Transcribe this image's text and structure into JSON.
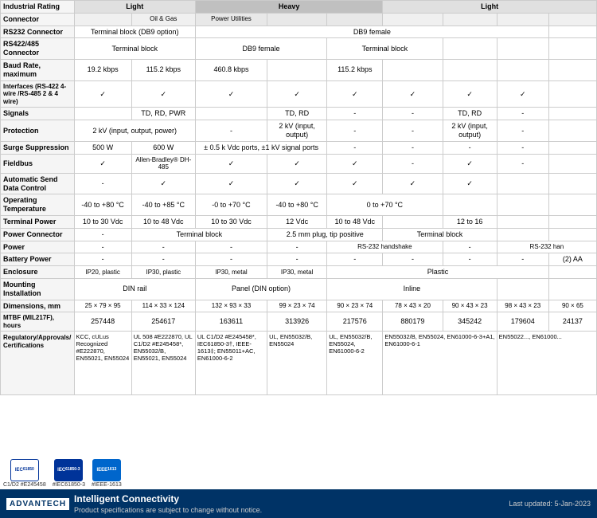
{
  "header": {
    "industrial_rating_label": "Industrial Rating",
    "cols": [
      "Light",
      "Heavy",
      "Light"
    ],
    "col_detail": [
      "Oil & Gas",
      "Power Utilities",
      ""
    ]
  },
  "rows": [
    {
      "label": "RS232 Connector",
      "values": [
        "Terminal block (DB9 option)",
        "DB9 female",
        "",
        "",
        "",
        "",
        "",
        ""
      ]
    },
    {
      "label": "RS422/485 Connector",
      "values": [
        "Terminal block",
        "",
        "DB9 female",
        "Terminal block",
        "",
        "",
        "",
        ""
      ]
    },
    {
      "label": "Baud Rate, maximum",
      "values": [
        "19.2 kbps",
        "115.2 kbps",
        "460.8 kbps",
        "",
        "115.2 kbps",
        "",
        "",
        ""
      ]
    },
    {
      "label": "Interfaces (RS-422 4-wire /RS-485 2 & 4 wire)",
      "values": [
        "✓",
        "✓",
        "✓",
        "✓",
        "✓",
        "✓",
        "✓",
        "✓"
      ]
    },
    {
      "label": "Signals",
      "values": [
        "",
        "TD, RD, PWR",
        "",
        "TD, RD",
        "-",
        "-",
        "TD, RD",
        "-"
      ]
    },
    {
      "label": "Protection",
      "values": [
        "2 kV (input, output, power)",
        "",
        "2 kV (input, output)",
        "-",
        "-",
        "2 kV (input, output)",
        "-"
      ]
    },
    {
      "label": "Surge Suppression",
      "values": [
        "500 W",
        "600 W",
        "± 0.5 k Vdc ports, ±1 kV signal ports",
        "-",
        "-",
        "-",
        "-"
      ]
    },
    {
      "label": "Fieldbus",
      "values": [
        "✓",
        "Allen-Bradley® DH-485",
        "✓",
        "✓",
        "✓",
        "-",
        "✓",
        "-"
      ]
    },
    {
      "label": "Automatic Send Data Control",
      "values": [
        "-",
        "✓",
        "✓",
        "✓",
        "✓",
        "✓",
        "",
        ""
      ]
    },
    {
      "label": "Operating Temperature",
      "values": [
        "-40 to +80 °C",
        "-40 to +85 °C",
        "-0 to +70 °C",
        "-40 to +80 °C",
        "0 to +70 °C",
        "",
        ""
      ]
    },
    {
      "label": "Terminal Power",
      "values": [
        "10 to 30 Vdc",
        "10 to 48 Vdc",
        "10 to 30 Vdc",
        "12 Vdc",
        "10 to 48 Vdc",
        "12 to 16",
        ""
      ]
    },
    {
      "label": "Power Connector",
      "values": [
        "-",
        "Terminal block",
        "",
        "2.5 mm plug, tip positive",
        "Terminal block",
        "",
        ""
      ]
    },
    {
      "label": "Power",
      "values": [
        "-",
        "-",
        "-",
        "-",
        "RS-232 handshake",
        "-",
        "RS-232 han"
      ]
    },
    {
      "label": "Battery Power",
      "values": [
        "-",
        "-",
        "-",
        "-",
        "-",
        "-",
        "(2) AA"
      ]
    },
    {
      "label": "Enclosure",
      "values": [
        "IP20, plastic",
        "IP30, plastic",
        "IP30, metal",
        "IP30, metal",
        "Plastic",
        "",
        ""
      ]
    },
    {
      "label": "Mounting Installation",
      "values": [
        "DIN rail",
        "",
        "Panel (DIN option)",
        "",
        "Inline",
        "",
        ""
      ]
    },
    {
      "label": "Dimensions, mm",
      "values": [
        "25 × 79 × 95",
        "114 × 33 × 124",
        "132 × 93 × 33",
        "99 × 23 × 74",
        "90 × 23 × 74",
        "78 × 43 × 20",
        "90 × 43 × 23",
        "98 × 43 × 23",
        "90 × 65"
      ]
    },
    {
      "label": "MTBF (MIL217F), hours",
      "values": [
        "257448",
        "254617",
        "163611",
        "313926",
        "217576",
        "880179",
        "345242",
        "179604",
        "24137"
      ]
    }
  ],
  "certifications_row": {
    "label": "Regulatory/Approvals/ Certifications",
    "cells": [
      "KCC, cULus Recognized #E222870, EN55021, EN55024",
      "UL 508 #E222870, UL C1/D2 #E245458*, EN55032/B, EN55021, EN55024",
      "UL C1/D2 #E245458*, IEC61850-3†, IEEE-1613‡; EN55011+AC, EN61000-6-2",
      "UL, EN55032/B, EN55024",
      "UL, EN55032/B, EN55024, EN61000-6-2",
      "EN55032/B, EN55024, EN61000-6-3+A1, EN61000-6-1",
      "EN55022..., EN61000..."
    ]
  },
  "cert_logos": [
    {
      "label": "C1/D2 #E245458",
      "icon": "IEC61850-3"
    },
    {
      "label": "#IEC61850-3",
      "icon": "IEC"
    },
    {
      "label": "#IEEE-1613",
      "icon": "IEEE"
    }
  ],
  "footer": {
    "brand": "ADVANTECH",
    "tagline": "Intelligent Connectivity",
    "disclaimer": "Product specifications are subject to change without notice.",
    "updated": "Last updated: 5-Jan-2023"
  }
}
